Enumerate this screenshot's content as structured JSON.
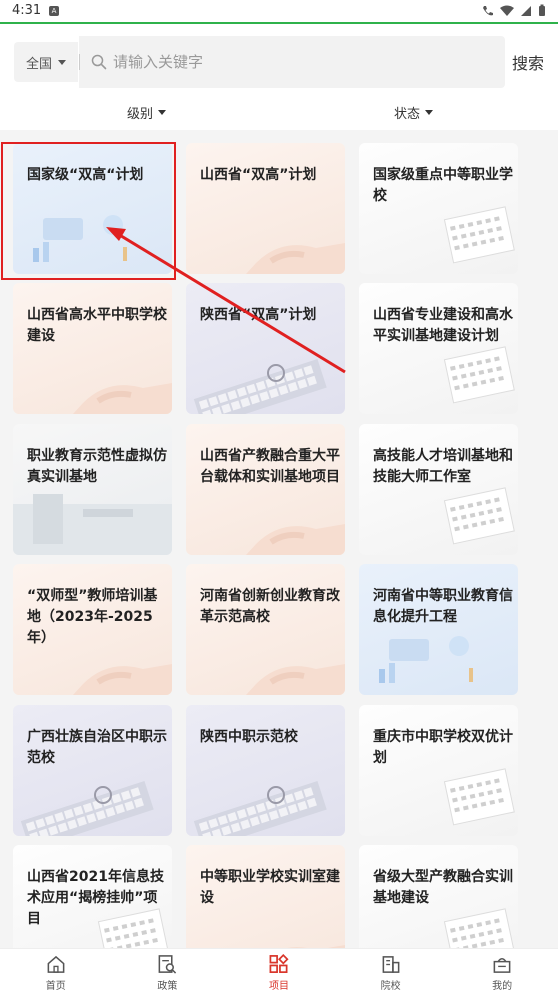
{
  "status_bar": {
    "time": "4:31",
    "badge": "A"
  },
  "search": {
    "region_label": "全国",
    "placeholder": "请输入关键字",
    "button_label": "搜索"
  },
  "filters": {
    "level_label": "级别",
    "status_label": "状态"
  },
  "cards": [
    {
      "title": "国家级“双高“计划",
      "theme": "blue"
    },
    {
      "title": "山西省“双高”计划",
      "theme": "peach"
    },
    {
      "title": "国家级重点中等职业学校",
      "theme": "white"
    },
    {
      "title": "山西省高水平中职学校建设",
      "theme": "peach"
    },
    {
      "title": "陕西省“双高”计划",
      "theme": "purple"
    },
    {
      "title": "山西省专业建设和高水平实训基地建设计划",
      "theme": "white"
    },
    {
      "title": "职业教育示范性虚拟仿真实训基地",
      "theme": "gray"
    },
    {
      "title": "山西省产教融合重大平台载体和实训基地项目",
      "theme": "peach"
    },
    {
      "title": "高技能人才培训基地和技能大师工作室",
      "theme": "white"
    },
    {
      "title": "“双师型”教师培训基地（2023年-2025年）",
      "theme": "peach"
    },
    {
      "title": "河南省创新创业教育改革示范高校",
      "theme": "peach"
    },
    {
      "title": "河南省中等职业教育信息化提升工程",
      "theme": "blue"
    },
    {
      "title": "广西壮族自治区中职示范校",
      "theme": "purple"
    },
    {
      "title": "陕西中职示范校",
      "theme": "purple"
    },
    {
      "title": "重庆市中职学校双优计划",
      "theme": "white"
    },
    {
      "title": "山西省2021年信息技术应用“揭榜挂帅”项目",
      "theme": "white"
    },
    {
      "title": "中等职业学校实训室建设",
      "theme": "peach"
    },
    {
      "title": "省级大型产教融合实训基地建设",
      "theme": "white"
    }
  ],
  "bottom_nav": [
    {
      "label": "首页",
      "icon": "home-icon",
      "active": false
    },
    {
      "label": "政策",
      "icon": "policy-search-icon",
      "active": false
    },
    {
      "label": "项目",
      "icon": "project-grid-icon",
      "active": true
    },
    {
      "label": "院校",
      "icon": "school-building-icon",
      "active": false
    },
    {
      "label": "我的",
      "icon": "profile-tray-icon",
      "active": false
    }
  ],
  "colors": {
    "accent": "#d9362b",
    "progress": "#2fb24b",
    "annotation": "#e02020"
  }
}
